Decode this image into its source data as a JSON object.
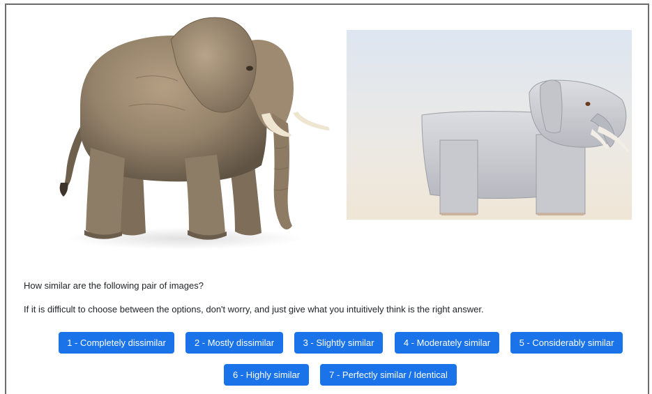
{
  "survey": {
    "question": "How similar are the following pair of images?",
    "instruction": "If it is difficult to choose between the options, don't worry, and just give what you intuitively think is the right answer."
  },
  "images": {
    "left": "elephant-photo",
    "right": "elephant-cartoon-drawing"
  },
  "options": [
    "1 - Completely dissimilar",
    "2 - Mostly dissimilar",
    "3 - Slightly similar",
    "4 - Moderately similar",
    "5 - Considerably similar",
    "6 - Highly similar",
    "7 - Perfectly similar / Identical"
  ],
  "colors": {
    "button": "#1a73e8",
    "button_text": "#ffffff",
    "text": "#212529",
    "frame_border": "#6b6b6b"
  }
}
